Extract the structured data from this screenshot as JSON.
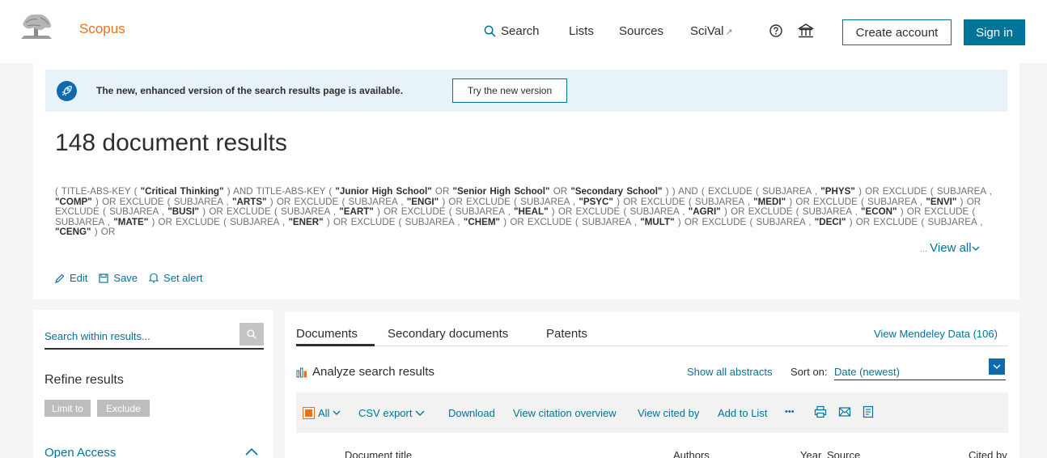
{
  "header": {
    "brand": "Scopus",
    "nav": {
      "search": "Search",
      "lists": "Lists",
      "sources": "Sources",
      "scival": "SciVal",
      "scival_ext": "↗"
    },
    "create_account": "Create account",
    "sign_in": "Sign in"
  },
  "banner": {
    "text": "The new, enhanced version of the search results page is available.",
    "button": "Try the new version"
  },
  "results": {
    "title": "148 document results",
    "view_all": "View all",
    "view_all_prefix": "...",
    "actions": {
      "edit": "Edit",
      "save": "Save",
      "set_alert": "Set alert"
    }
  },
  "query": [
    {
      "t": "( TITLE-ABS-KEY ( "
    },
    {
      "t": "\"Critical Thinking\"",
      "b": true
    },
    {
      "t": " )  AND  TITLE-ABS-KEY ( "
    },
    {
      "t": "\"Junior High School\"",
      "b": true
    },
    {
      "t": "  OR  "
    },
    {
      "t": "\"Senior High School\"",
      "b": true
    },
    {
      "t": "  OR  "
    },
    {
      "t": "\"Secondary School\"",
      "b": true
    },
    {
      "t": " ) )  AND  ( EXCLUDE ( SUBJAREA ,  "
    },
    {
      "t": "\"PHYS\"",
      "b": true
    },
    {
      "t": " )  OR  EXCLUDE ( SUBJAREA ,  "
    },
    {
      "t": "\"COMP\"",
      "b": true
    },
    {
      "t": " )  OR  EXCLUDE ( SUBJAREA ,  "
    },
    {
      "t": "\"ARTS\"",
      "b": true
    },
    {
      "t": " )  OR  EXCLUDE ( SUBJAREA ,  "
    },
    {
      "t": "\"ENGI\"",
      "b": true
    },
    {
      "t": " )  OR  EXCLUDE ( SUBJAREA ,  "
    },
    {
      "t": "\"PSYC\"",
      "b": true
    },
    {
      "t": " )  OR  EXCLUDE ( SUBJAREA ,  "
    },
    {
      "t": "\"MEDI\"",
      "b": true
    },
    {
      "t": " )  OR  EXCLUDE ( SUBJAREA ,  "
    },
    {
      "t": "\"ENVI\"",
      "b": true
    },
    {
      "t": " )  OR  EXCLUDE ( SUBJAREA ,  "
    },
    {
      "t": "\"BUSI\"",
      "b": true
    },
    {
      "t": " )  OR  EXCLUDE ( SUBJAREA ,  "
    },
    {
      "t": "\"EART\"",
      "b": true
    },
    {
      "t": " )  OR  EXCLUDE ( SUBJAREA ,  "
    },
    {
      "t": "\"HEAL\"",
      "b": true
    },
    {
      "t": " )  OR  EXCLUDE ( SUBJAREA ,  "
    },
    {
      "t": "\"AGRI\"",
      "b": true
    },
    {
      "t": " )  OR  EXCLUDE ( SUBJAREA ,  "
    },
    {
      "t": "\"ECON\"",
      "b": true
    },
    {
      "t": " )  OR  EXCLUDE ( SUBJAREA ,  "
    },
    {
      "t": "\"MATE\"",
      "b": true
    },
    {
      "t": " )  OR  EXCLUDE ( SUBJAREA ,  "
    },
    {
      "t": "\"ENER\"",
      "b": true
    },
    {
      "t": " )  OR  EXCLUDE ( SUBJAREA ,  "
    },
    {
      "t": "\"CHEM\"",
      "b": true
    },
    {
      "t": " )  OR  EXCLUDE ( SUBJAREA ,  "
    },
    {
      "t": "\"MULT\"",
      "b": true
    },
    {
      "t": " )  OR  EXCLUDE ( SUBJAREA ,  "
    },
    {
      "t": "\"DECI\"",
      "b": true
    },
    {
      "t": " )  OR  EXCLUDE ( SUBJAREA ,  "
    },
    {
      "t": "\"CENG\"",
      "b": true
    },
    {
      "t": " )  OR"
    }
  ],
  "sidebar": {
    "search_placeholder": "Search within results...",
    "refine_title": "Refine results",
    "limit_to": "Limit to",
    "exclude": "Exclude",
    "open_access": "Open Access"
  },
  "main": {
    "tabs": [
      "Documents",
      "Secondary documents",
      "Patents"
    ],
    "mendeley": "View Mendeley Data (106)",
    "analyze": "Analyze search results",
    "show_abstracts": "Show all abstracts",
    "sort_label": "Sort on:",
    "sort_value": "Date (newest)",
    "toolbar": {
      "all": "All",
      "csv_export": "CSV export",
      "download": "Download",
      "view_citation": "View citation overview",
      "view_cited_by": "View cited by",
      "add_to_list": "Add to List",
      "more": "•••"
    },
    "columns": {
      "document_title": "Document title",
      "authors": "Authors",
      "year": "Year",
      "source": "Source",
      "cited_by": "Cited by"
    }
  },
  "colors": {
    "accent": "#007398",
    "brand": "#e9711c",
    "banner": "#e7f2f9"
  }
}
